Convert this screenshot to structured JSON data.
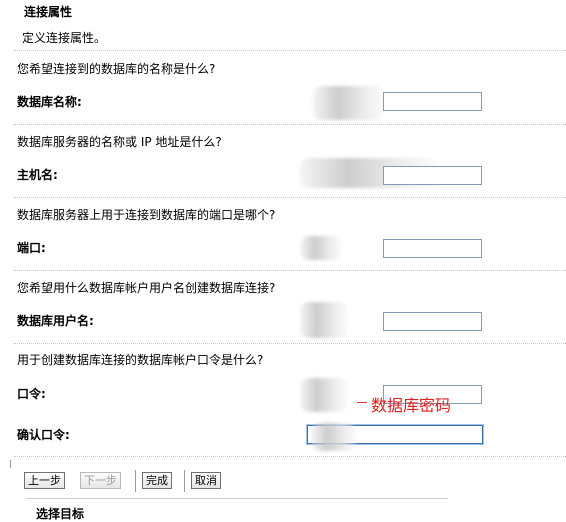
{
  "header": {
    "title": "连接属性",
    "subtitle": "定义连接属性。"
  },
  "sections": [
    {
      "question": "您希望连接到的数据库的名称是什么?",
      "label": "数据库名称:",
      "value": ""
    },
    {
      "question": "数据库服务器的名称或 IP 地址是什么?",
      "label": "主机名:",
      "value": ""
    },
    {
      "question": "数据库服务器上用于连接到数据库的端口是哪个?",
      "label": "端口:",
      "value": ""
    },
    {
      "question": "您希望用什么数据库帐户用户名创建数据库连接?",
      "label": "数据库用户名:",
      "value": ""
    },
    {
      "question": "用于创建数据库连接的数据库帐户口令是什么?",
      "label": "口令:",
      "value": ""
    }
  ],
  "confirm": {
    "label": "确认口令:",
    "value": ""
  },
  "annotation": {
    "text": "数据库密码",
    "color": "#e02020"
  },
  "buttons": {
    "back": "上一步",
    "next": "下一步",
    "finish": "完成",
    "cancel": "取消"
  },
  "next_section": {
    "title": "选择目标"
  }
}
